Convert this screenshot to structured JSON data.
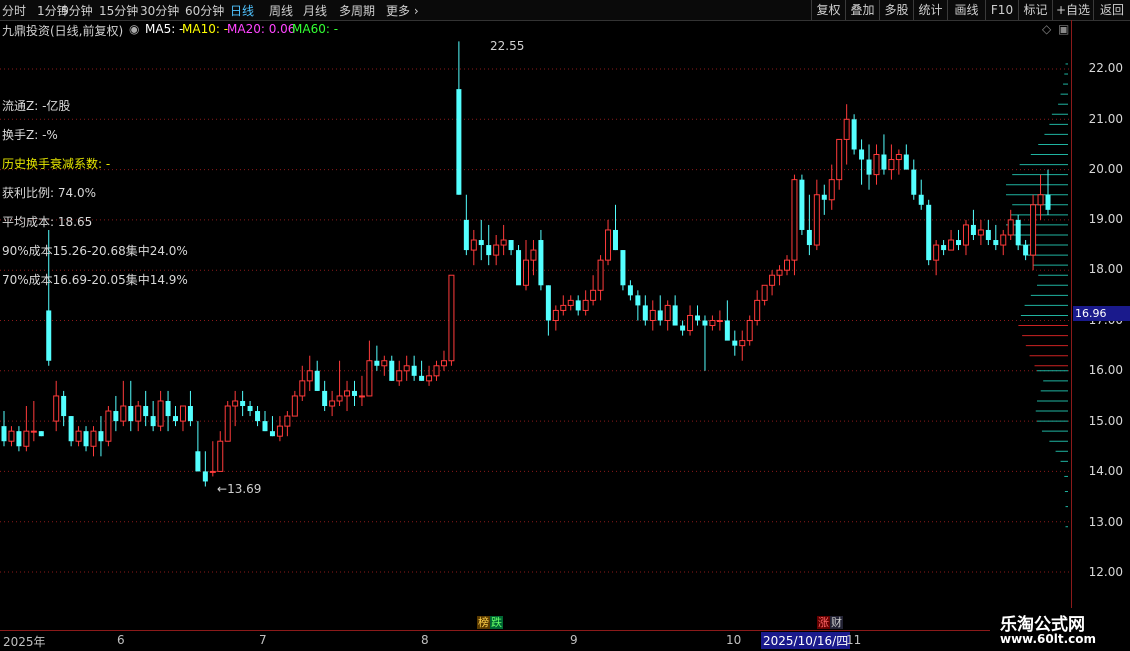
{
  "toolbar": {
    "periods": [
      "分时",
      "1分钟",
      "5分钟",
      "15分钟",
      "30分钟",
      "60分钟",
      "日线",
      "周线",
      "月线",
      "多周期",
      "更多"
    ],
    "active_period": "日线",
    "right_buttons": [
      "复权",
      "叠加",
      "多股",
      "统计",
      "画线",
      "F10",
      "标记",
      "+自选",
      "返回"
    ]
  },
  "infobar": {
    "stock_title": "九鼎投资(日线,前复权)",
    "ma5": "MA5: -",
    "ma10": "MA10: -",
    "ma20": "MA20: 0.06",
    "ma60": "MA60: -"
  },
  "colors": {
    "up": "#ff3b3b",
    "down": "#54ffff",
    "ma5": "#ffffff",
    "ma10": "#ffff00",
    "ma20": "#ff44ff",
    "ma60": "#33ff33",
    "grid": "#8b1a1a",
    "chip_profile": "#1fb3a0",
    "chip_profit": "#cc2222"
  },
  "chip_info": {
    "float_shares": "流通Z: -亿股",
    "turnover": "换手Z: -%",
    "decay": "历史换手衰减系数: -",
    "profit_ratio": "获利比例: 74.0%",
    "avg_cost": "平均成本: 18.65",
    "cost90": "90%成本15.26-20.68集中24.0%",
    "cost70": "70%成本16.69-20.05集中14.9%"
  },
  "y_axis": {
    "labels": [
      "22.00",
      "21.00",
      "20.00",
      "19.00",
      "18.00",
      "17.00",
      "16.00",
      "15.00",
      "14.00",
      "13.00",
      "12.00"
    ],
    "current_price": "16.96"
  },
  "annotations": {
    "high": "22.55",
    "low": "13.69"
  },
  "bottom": {
    "dates": [
      "2025年",
      "6",
      "7",
      "8",
      "9",
      "10",
      "11"
    ],
    "highlight_date": "2025/10/16/四",
    "event1": "榜",
    "event2": "跌",
    "event3": "涨",
    "event4": "财"
  },
  "watermark": {
    "title": "乐淘公式网",
    "url": "www.60lt.com"
  },
  "chart_data": {
    "type": "candlestick",
    "ylim": [
      12.0,
      22.8
    ],
    "candles_ohlc": [
      [
        14.9,
        15.2,
        14.5,
        14.6
      ],
      [
        14.6,
        14.9,
        14.5,
        14.8
      ],
      [
        14.8,
        14.9,
        14.4,
        14.5
      ],
      [
        14.5,
        15.3,
        14.4,
        14.8
      ],
      [
        14.8,
        15.4,
        14.6,
        14.8
      ],
      [
        14.8,
        14.8,
        14.7,
        14.7
      ],
      [
        17.2,
        18.8,
        16.1,
        16.2
      ],
      [
        15.0,
        15.8,
        14.8,
        15.5
      ],
      [
        15.5,
        15.6,
        14.9,
        15.1
      ],
      [
        15.1,
        15.1,
        14.5,
        14.6
      ],
      [
        14.6,
        14.9,
        14.5,
        14.8
      ],
      [
        14.8,
        14.9,
        14.4,
        14.5
      ],
      [
        14.5,
        14.9,
        14.3,
        14.8
      ],
      [
        14.8,
        15.1,
        14.3,
        14.6
      ],
      [
        14.6,
        15.3,
        14.5,
        15.2
      ],
      [
        15.2,
        15.5,
        14.8,
        15.0
      ],
      [
        15.0,
        15.8,
        14.9,
        15.3
      ],
      [
        15.3,
        15.8,
        14.8,
        15.0
      ],
      [
        15.0,
        15.4,
        14.8,
        15.3
      ],
      [
        15.3,
        15.6,
        14.9,
        15.1
      ],
      [
        15.1,
        15.4,
        14.8,
        14.9
      ],
      [
        14.9,
        15.6,
        14.8,
        15.4
      ],
      [
        15.4,
        15.6,
        14.8,
        15.1
      ],
      [
        15.1,
        15.3,
        14.9,
        15.0
      ],
      [
        15.0,
        15.3,
        14.8,
        15.3
      ],
      [
        15.3,
        15.6,
        14.9,
        15.0
      ],
      [
        14.4,
        15.0,
        14.0,
        14.0
      ],
      [
        14.0,
        14.4,
        13.7,
        13.8
      ],
      [
        14.0,
        14.6,
        13.9,
        14.0
      ],
      [
        14.0,
        14.8,
        14.0,
        14.6
      ],
      [
        14.6,
        15.4,
        14.6,
        15.3
      ],
      [
        15.3,
        15.6,
        14.9,
        15.4
      ],
      [
        15.4,
        15.6,
        15.1,
        15.3
      ],
      [
        15.3,
        15.4,
        15.1,
        15.2
      ],
      [
        15.2,
        15.3,
        14.9,
        15.0
      ],
      [
        15.0,
        15.2,
        14.8,
        14.8
      ],
      [
        14.8,
        15.1,
        14.7,
        14.7
      ],
      [
        14.7,
        15.1,
        14.6,
        14.9
      ],
      [
        14.9,
        15.2,
        14.7,
        15.1
      ],
      [
        15.1,
        15.6,
        15.1,
        15.5
      ],
      [
        15.5,
        16.1,
        15.4,
        15.8
      ],
      [
        15.8,
        16.3,
        15.6,
        16.0
      ],
      [
        16.0,
        16.2,
        15.6,
        15.6
      ],
      [
        15.6,
        15.8,
        15.2,
        15.3
      ],
      [
        15.3,
        15.6,
        15.1,
        15.4
      ],
      [
        15.4,
        16.2,
        15.3,
        15.5
      ],
      [
        15.5,
        15.8,
        15.2,
        15.6
      ],
      [
        15.6,
        15.8,
        15.3,
        15.5
      ],
      [
        15.5,
        15.9,
        15.3,
        15.5
      ],
      [
        15.5,
        16.6,
        15.5,
        16.2
      ],
      [
        16.2,
        16.5,
        16.0,
        16.1
      ],
      [
        16.1,
        16.3,
        15.9,
        16.2
      ],
      [
        16.2,
        16.3,
        15.8,
        15.8
      ],
      [
        15.8,
        16.2,
        15.7,
        16.0
      ],
      [
        16.0,
        16.3,
        15.8,
        16.1
      ],
      [
        16.1,
        16.3,
        15.8,
        15.9
      ],
      [
        15.9,
        16.2,
        15.8,
        15.8
      ],
      [
        15.8,
        16.1,
        15.7,
        15.9
      ],
      [
        15.9,
        16.2,
        15.8,
        16.1
      ],
      [
        16.1,
        16.4,
        16.0,
        16.2
      ],
      [
        16.2,
        17.9,
        16.1,
        17.9
      ],
      [
        21.6,
        22.55,
        19.5,
        19.5
      ],
      [
        19.0,
        19.5,
        18.3,
        18.4
      ],
      [
        18.4,
        18.8,
        18.1,
        18.6
      ],
      [
        18.6,
        19.0,
        18.2,
        18.5
      ],
      [
        18.5,
        18.9,
        18.1,
        18.3
      ],
      [
        18.3,
        18.7,
        18.1,
        18.5
      ],
      [
        18.5,
        18.9,
        18.3,
        18.6
      ],
      [
        18.6,
        18.6,
        18.3,
        18.4
      ],
      [
        18.4,
        18.5,
        17.8,
        17.7
      ],
      [
        17.7,
        18.6,
        17.6,
        18.2
      ],
      [
        18.2,
        18.6,
        17.9,
        18.4
      ],
      [
        18.6,
        18.8,
        17.6,
        17.7
      ],
      [
        17.7,
        17.7,
        16.7,
        17.0
      ],
      [
        17.0,
        17.3,
        16.8,
        17.2
      ],
      [
        17.2,
        17.5,
        17.1,
        17.3
      ],
      [
        17.3,
        17.5,
        17.2,
        17.4
      ],
      [
        17.4,
        17.5,
        17.1,
        17.2
      ],
      [
        17.2,
        17.6,
        17.1,
        17.4
      ],
      [
        17.4,
        17.9,
        17.3,
        17.6
      ],
      [
        17.6,
        18.3,
        17.4,
        18.2
      ],
      [
        18.2,
        19.0,
        18.1,
        18.8
      ],
      [
        18.8,
        19.3,
        18.4,
        18.4
      ],
      [
        18.4,
        18.4,
        17.6,
        17.7
      ],
      [
        17.7,
        17.8,
        17.4,
        17.5
      ],
      [
        17.5,
        17.6,
        17.0,
        17.3
      ],
      [
        17.3,
        17.5,
        16.9,
        17.0
      ],
      [
        17.0,
        17.4,
        16.8,
        17.2
      ],
      [
        17.2,
        17.5,
        16.9,
        17.0
      ],
      [
        17.0,
        17.4,
        16.8,
        17.3
      ],
      [
        17.3,
        17.5,
        16.9,
        16.9
      ],
      [
        16.9,
        17.0,
        16.7,
        16.8
      ],
      [
        16.8,
        17.3,
        16.7,
        17.1
      ],
      [
        17.1,
        17.3,
        16.9,
        17.0
      ],
      [
        17.0,
        17.1,
        16.0,
        16.9
      ],
      [
        16.9,
        17.1,
        16.8,
        17.0
      ],
      [
        17.0,
        17.2,
        16.8,
        17.0
      ],
      [
        17.0,
        17.4,
        16.8,
        16.6
      ],
      [
        16.6,
        16.8,
        16.3,
        16.5
      ],
      [
        16.5,
        16.8,
        16.2,
        16.6
      ],
      [
        16.6,
        17.1,
        16.5,
        17.0
      ],
      [
        17.0,
        17.6,
        16.9,
        17.4
      ],
      [
        17.4,
        17.7,
        17.3,
        17.7
      ],
      [
        17.7,
        18.0,
        17.5,
        17.9
      ],
      [
        17.9,
        18.1,
        17.7,
        18.0
      ],
      [
        18.0,
        18.3,
        17.9,
        18.2
      ],
      [
        18.2,
        19.9,
        17.9,
        19.8
      ],
      [
        19.8,
        19.9,
        18.7,
        18.8
      ],
      [
        18.8,
        19.5,
        18.3,
        18.5
      ],
      [
        18.5,
        19.8,
        18.4,
        19.5
      ],
      [
        19.5,
        19.7,
        19.1,
        19.4
      ],
      [
        19.4,
        20.1,
        19.2,
        19.8
      ],
      [
        19.8,
        20.3,
        19.6,
        20.6
      ],
      [
        20.6,
        21.3,
        20.1,
        21.0
      ],
      [
        21.0,
        21.1,
        20.3,
        20.4
      ],
      [
        20.4,
        20.6,
        19.7,
        20.2
      ],
      [
        20.2,
        20.5,
        19.6,
        19.9
      ],
      [
        19.9,
        20.5,
        19.7,
        20.3
      ],
      [
        20.3,
        20.7,
        19.9,
        20.0
      ],
      [
        20.0,
        20.5,
        19.8,
        20.2
      ],
      [
        20.2,
        20.4,
        19.9,
        20.3
      ],
      [
        20.3,
        20.5,
        20.0,
        20.0
      ],
      [
        20.0,
        20.2,
        19.4,
        19.5
      ],
      [
        19.5,
        19.8,
        19.2,
        19.3
      ],
      [
        19.3,
        19.4,
        18.1,
        18.2
      ],
      [
        18.2,
        18.6,
        17.9,
        18.5
      ],
      [
        18.5,
        18.6,
        18.3,
        18.4
      ],
      [
        18.4,
        18.8,
        18.4,
        18.6
      ],
      [
        18.6,
        18.8,
        18.4,
        18.5
      ],
      [
        18.5,
        19.0,
        18.3,
        18.9
      ],
      [
        18.9,
        19.2,
        18.6,
        18.7
      ],
      [
        18.7,
        19.0,
        18.5,
        18.8
      ],
      [
        18.8,
        19.0,
        18.5,
        18.6
      ],
      [
        18.6,
        18.9,
        18.4,
        18.5
      ],
      [
        18.5,
        18.8,
        18.3,
        18.7
      ],
      [
        18.7,
        19.2,
        18.6,
        19.0
      ],
      [
        19.0,
        19.1,
        18.4,
        18.5
      ],
      [
        18.5,
        18.6,
        18.2,
        18.3
      ],
      [
        18.3,
        19.5,
        18.0,
        19.3
      ],
      [
        19.3,
        19.9,
        19.0,
        19.5
      ],
      [
        19.5,
        20.0,
        19.1,
        19.2
      ]
    ],
    "profile_up_prices": [
      16.1,
      16.3,
      16.5,
      16.7,
      16.9
    ],
    "profile_down_prices": [
      12.9,
      13.3,
      13.6,
      13.9,
      14.2,
      14.4,
      14.6,
      14.8,
      15.0,
      15.2,
      15.4,
      15.6,
      15.8,
      16.0,
      17.1,
      17.3,
      17.5,
      17.7,
      17.9,
      18.1,
      18.3,
      18.5,
      18.7,
      18.9,
      19.1,
      19.3,
      19.5,
      19.7,
      19.9,
      20.1,
      20.3,
      20.5,
      20.7,
      20.9,
      21.1,
      21.3,
      21.5,
      21.7,
      21.9,
      22.1
    ],
    "profile_up_widths": [
      0.54,
      0.62,
      0.68,
      0.74,
      0.8
    ],
    "profile_down_widths": [
      0.04,
      0.04,
      0.05,
      0.06,
      0.12,
      0.2,
      0.3,
      0.42,
      0.5,
      0.52,
      0.5,
      0.44,
      0.4,
      0.5,
      0.76,
      0.7,
      0.6,
      0.5,
      0.48,
      0.56,
      0.72,
      0.84,
      0.96,
      1.0,
      0.92,
      0.9,
      1.0,
      1.0,
      0.9,
      0.78,
      0.6,
      0.48,
      0.38,
      0.3,
      0.26,
      0.16,
      0.12,
      0.08,
      0.06,
      0.04
    ]
  }
}
